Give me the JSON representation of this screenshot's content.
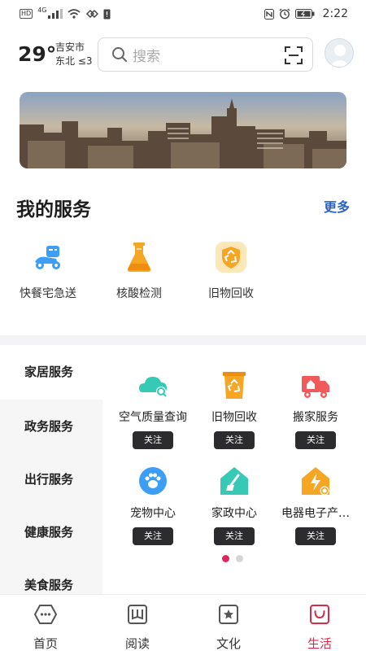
{
  "status_bar": {
    "network": "HD",
    "network_gen": "4G",
    "time": "2:22"
  },
  "weather": {
    "temperature": "29°",
    "city": "吉安市",
    "wind": "东北  ≤3"
  },
  "search": {
    "placeholder": "搜索"
  },
  "my_services": {
    "title": "我的服务",
    "more": "更多",
    "items": [
      {
        "label": "快餐宅急送",
        "icon": "delivery-scooter-icon"
      },
      {
        "label": "核酸检测",
        "icon": "flask-icon"
      },
      {
        "label": "旧物回收",
        "icon": "recycle-badge-icon"
      }
    ]
  },
  "categories": [
    "家居服务",
    "政务服务",
    "出行服务",
    "健康服务",
    "美食服务"
  ],
  "grid_items": [
    {
      "label": "空气质量查询",
      "button": "关注",
      "icon": "air-quality-icon"
    },
    {
      "label": "旧物回收",
      "button": "关注",
      "icon": "recycle-bin-icon"
    },
    {
      "label": "搬家服务",
      "button": "关注",
      "icon": "moving-truck-icon"
    },
    {
      "label": "宠物中心",
      "button": "关注",
      "icon": "paw-icon"
    },
    {
      "label": "家政中心",
      "button": "关注",
      "icon": "housekeeping-icon"
    },
    {
      "label": "电器电子产…",
      "button": "关注",
      "icon": "electric-house-icon"
    }
  ],
  "pagination": {
    "pages": 2,
    "current": 1
  },
  "bottom_nav": [
    {
      "label": "首页",
      "icon": "home-icon",
      "active": false
    },
    {
      "label": "阅读",
      "icon": "book-icon",
      "active": false
    },
    {
      "label": "文化",
      "icon": "culture-star-icon",
      "active": false
    },
    {
      "label": "生活",
      "icon": "life-bag-icon",
      "active": true
    }
  ],
  "colors": {
    "accent": "#d62b4b",
    "link": "#2a62c9",
    "icon_blue": "#3d9ef5",
    "icon_orange": "#f5a623",
    "icon_teal": "#35c9b6",
    "icon_red": "#f05a5a"
  }
}
